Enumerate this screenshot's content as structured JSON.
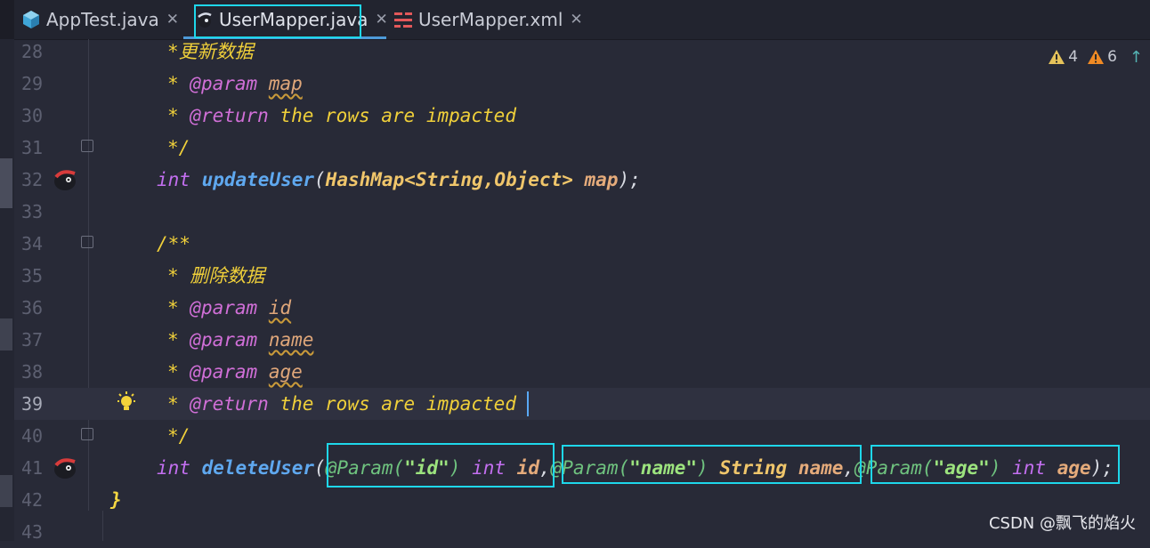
{
  "tabs": [
    {
      "label": "AppTest.java",
      "icon": "java-class-icon"
    },
    {
      "label": "UserMapper.java",
      "icon": "mybatis-interface-icon",
      "active": true
    },
    {
      "label": "UserMapper.xml",
      "icon": "xml-mapper-icon"
    }
  ],
  "inspections": {
    "warnings_yellow": "4",
    "warnings_orange": "6"
  },
  "lines": [
    {
      "num": "28"
    },
    {
      "num": "29"
    },
    {
      "num": "30"
    },
    {
      "num": "31"
    },
    {
      "num": "32"
    },
    {
      "num": "33"
    },
    {
      "num": "34"
    },
    {
      "num": "35"
    },
    {
      "num": "36"
    },
    {
      "num": "37"
    },
    {
      "num": "38"
    },
    {
      "num": "39"
    },
    {
      "num": "40"
    },
    {
      "num": "41"
    },
    {
      "num": "42"
    },
    {
      "num": "43"
    }
  ],
  "code": {
    "l28": {
      "text": "*更新数据"
    },
    "l29": {
      "star": "* ",
      "tag": "@param",
      "param": "map"
    },
    "l30": {
      "star": "* ",
      "tag": "@return",
      "text": " the rows are impacted"
    },
    "l31": {
      "text": "*/"
    },
    "l32": {
      "kw": "int",
      "fn": "updateUser",
      "open": "(",
      "type": "HashMap<String,Object>",
      "var": "map",
      "close": ");"
    },
    "l34": {
      "text": "/**"
    },
    "l35": {
      "text": "* 删除数据"
    },
    "l36": {
      "star": "* ",
      "tag": "@param",
      "param": "id"
    },
    "l37": {
      "star": "* ",
      "tag": "@param",
      "param": "name"
    },
    "l38": {
      "star": "* ",
      "tag": "@param",
      "param": "age"
    },
    "l39": {
      "star": "* ",
      "tag": "@return",
      "text": " the rows are impacted"
    },
    "l40": {
      "text": "*/"
    },
    "l41": {
      "kw": "int",
      "fn": "deleteUser",
      "open": "(",
      "ann1": "@Param(",
      "str1": "\"id\"",
      "ann1c": ")",
      "kw1": "int",
      "var1": "id",
      "comma1": ",",
      "ann2": "@Param(",
      "str2": "\"name\"",
      "ann2c": ")",
      "type2": "String",
      "var2": "name",
      "comma2": ",",
      "ann3": "@Param(",
      "str3": "\"age\"",
      "ann3c": ")",
      "kw3": "int",
      "var3": "age",
      "close": ");"
    },
    "l42": {
      "text": "}"
    }
  },
  "watermark": "CSDN @飘飞的焰火"
}
